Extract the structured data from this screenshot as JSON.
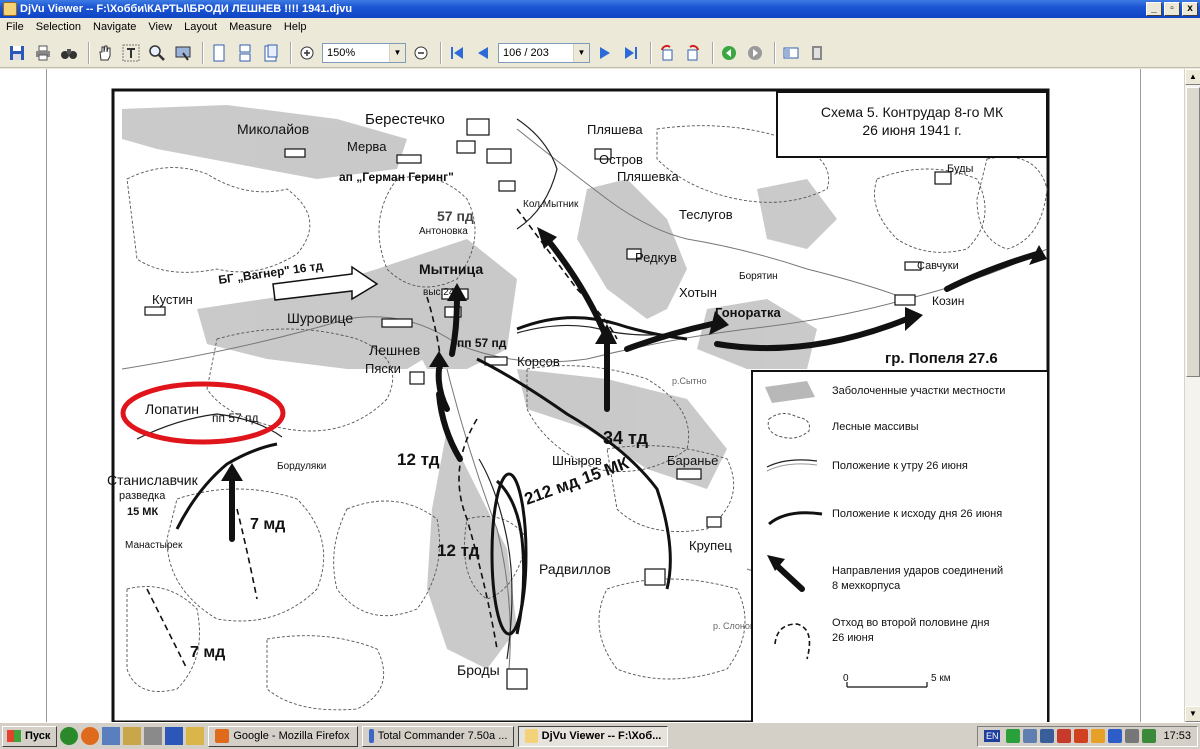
{
  "window": {
    "title": "DjVu Viewer -- F:\\Хобби\\КАРТЫ\\БРОДИ ЛЕШНЕВ !!!! 1941.djvu",
    "min_label": "_",
    "max_label": "▫",
    "close_label": "x"
  },
  "menu": [
    "File",
    "Selection",
    "Navigate",
    "View",
    "Layout",
    "Measure",
    "Help"
  ],
  "toolbar": {
    "zoom_value": "150%",
    "page_value": "106 / 203"
  },
  "map": {
    "title_line1": "Схема 5. Контрудар 8-го МК",
    "title_line2": "26 июня 1941 г.",
    "places": {
      "berestechko": "Берестечко",
      "mykolaiv": "Миколайов",
      "merva": "Мерва",
      "plyasheva": "Пляшева",
      "ostrov": "Остров",
      "plyashevka": "Пляшевка",
      "budy": "Буды",
      "ap_goering": "ап „Герман Геринг\"",
      "kol_mytnik": "Кол.Мытник",
      "teslugov": "Теслугов",
      "pd57": "57 пд",
      "antonovka": "Антоновка",
      "redkuv": "Редкув",
      "boryatin": "Борятин",
      "savchuky": "Савчуки",
      "bg_wagner": "БГ „Вагнер\" 16 тд",
      "mytnytsa": "Мытница",
      "khotyn": "Хотын",
      "kostin": "Кустин",
      "vys241": "выс.241",
      "kozyn": "Козин",
      "shurovytse": "Шуровице",
      "gonoratka": "Гоноратка",
      "pp57_mid": "пп 57 пд",
      "group_popel": "гр. Попеля 27.6",
      "leshnev": "Лешнев",
      "pyasky": "Пяски",
      "korsov": "Корсов",
      "sytno": "р.Сытно",
      "lopatin": "Лопатин",
      "pp57_lop": "пп 57 пд",
      "td34": "34 тд",
      "td12_a": "12 тд",
      "shnyrov": "Шныров",
      "baranye": "Баранье",
      "bordulyaky": "Бордуляки",
      "stanislavchik": "Станиславчик",
      "razvedka": "разведка",
      "mk15": "15 МК",
      "md7_a": "7 мд",
      "md212": "212 мд 15 МК",
      "krupets": "Крупец",
      "manastyrek": "Манастырек",
      "td12_b": "12 тд",
      "radvyliv": "Радвиллов",
      "slonivka": "р. Слоновка",
      "md7_b": "7 мд",
      "brody": "Броды"
    },
    "legend": {
      "swamp": "Заболоченные участки местности",
      "forest": "Лесные массивы",
      "morning": "Положение к утру 26 июня",
      "evening": "Положение к исходу дня 26 июня",
      "attack_1": "Направления ударов соединений",
      "attack_2": "8 мехкорпуса",
      "retreat_1": "Отход во второй половине дня",
      "retreat_2": "26 июня",
      "scale_0": "0",
      "scale_5": "5 км"
    }
  },
  "taskbar": {
    "start": "Пуск",
    "tasks": [
      {
        "label": "Google - Mozilla Firefox",
        "active": false
      },
      {
        "label": "Total Commander 7.50a ...",
        "active": false
      },
      {
        "label": "DjVu Viewer -- F:\\Хоб...",
        "active": true
      }
    ],
    "lang": "EN",
    "clock": "17:53"
  },
  "colors": {
    "title_bar": "#0f45c4",
    "highlight_ring": "#e0141b",
    "swamp_fill": "#b8b8b8"
  }
}
